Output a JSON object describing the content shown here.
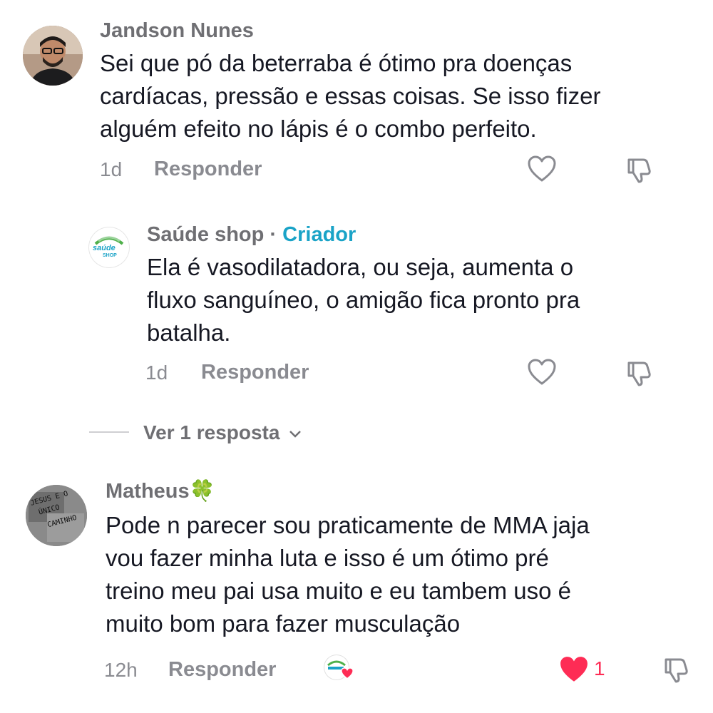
{
  "comments": [
    {
      "username": "Jandson Nunes",
      "text_lines": [
        "Sei que pó da beterraba é ótimo pra doenças",
        "cardíacas, pressão e essas coisas. Se isso fizer",
        "alguém efeito no lápis é o combo perfeito."
      ],
      "time": "1d",
      "reply_label": "Responder"
    },
    {
      "username": "Saúde shop",
      "separator": "·",
      "badge": "Criador",
      "avatar_text_top": "saúde",
      "avatar_text_bottom": "SHOP",
      "text_lines": [
        "Ela é vasodilatadora, ou seja, aumenta o",
        "fluxo sanguíneo, o amigão fica pronto pra",
        "batalha."
      ],
      "time": "1d",
      "reply_label": "Responder"
    },
    {
      "username": "Matheus",
      "username_emoji": "🍀",
      "avatar_lines": [
        "JESUS E O",
        "ÚNICO",
        "CAMINHO"
      ],
      "text_lines": [
        "Pode n parecer sou praticamente de MMA jaja",
        "vou fazer minha luta e isso é um ótimo pré",
        "treino meu pai usa muito e eu tambem uso é",
        "muito bom para fazer musculação"
      ],
      "time": "12h",
      "reply_label": "Responder",
      "like_count": "1"
    }
  ],
  "view_replies": "Ver 1 resposta",
  "colors": {
    "accent": "#1aa3c7",
    "like": "#fe2c55",
    "muted": "#8a8b91"
  }
}
